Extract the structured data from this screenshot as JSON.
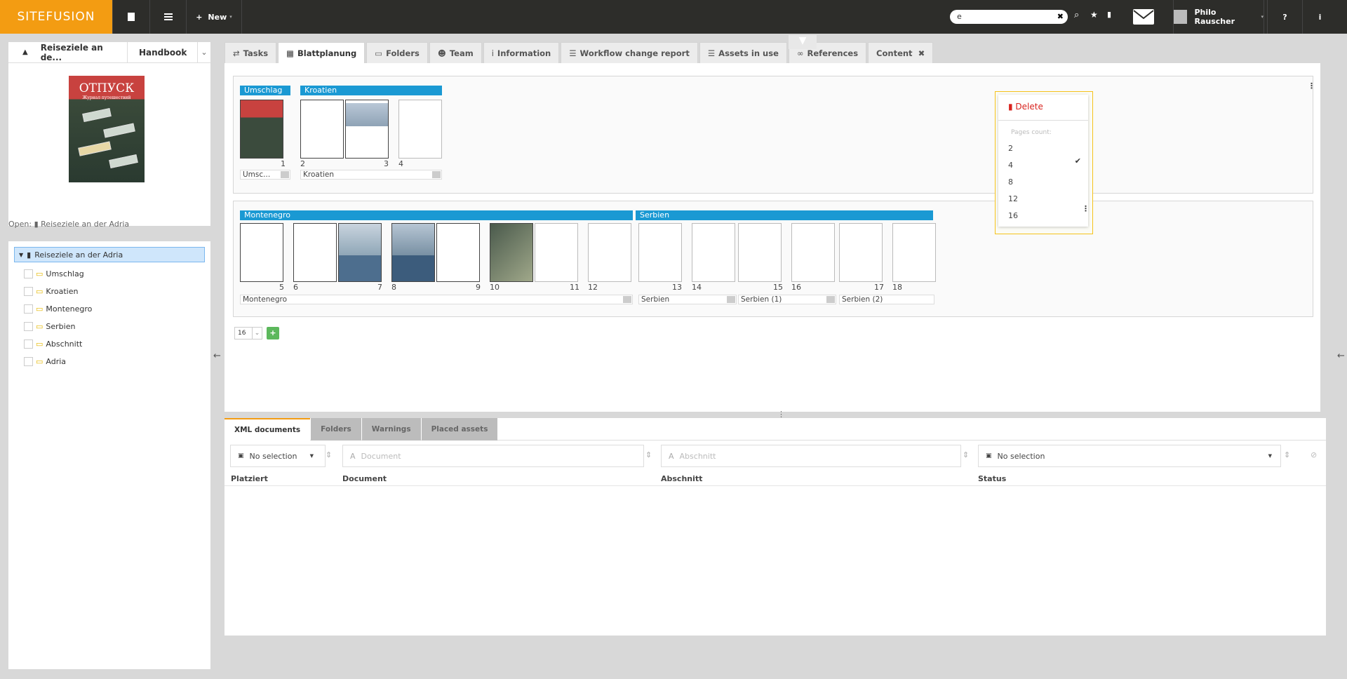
{
  "topbar": {
    "logo": "SITEFUSION",
    "new_label": "New",
    "search_value": "e",
    "user_name": "Philo Rauscher"
  },
  "left": {
    "doc_title": "Reiseziele an de...",
    "doc_type": "Handbook",
    "cover_title": "ОТПУСК",
    "cover_subtitle": "Журнал путешествий",
    "open_label": "Open:",
    "open_doc": "Reiseziele an der Adria",
    "tree_root": "Reiseziele an der Adria",
    "tree_items": [
      "Umschlag",
      "Kroatien",
      "Montenegro",
      "Serbien",
      "Abschnitt",
      "Adria"
    ]
  },
  "tabs": [
    "Tasks",
    "Blattplanung",
    "Folders",
    "Team",
    "Information",
    "Workflow change report",
    "Assets in use",
    "References",
    "Content"
  ],
  "planning": {
    "row1_chapters": [
      "Umschlag",
      "Kroatien"
    ],
    "row1_pages": [
      "1",
      "2",
      "3",
      "4"
    ],
    "row1_foot": [
      "Umsc...",
      "Kroatien"
    ],
    "row2_chapters": [
      "Montenegro",
      "Serbien"
    ],
    "row2_pages": [
      "5",
      "6",
      "7",
      "8",
      "9",
      "10",
      "11",
      "12",
      "13",
      "14",
      "15",
      "16",
      "17",
      "18"
    ],
    "row2_foot": [
      "Montenegro",
      "Serbien",
      "Serbien (1)",
      "Serbien (2)"
    ],
    "zoom": "16"
  },
  "dropdown": {
    "delete": "Delete",
    "caption": "Pages count:",
    "options": [
      "2",
      "4",
      "8",
      "12",
      "16"
    ],
    "selected": "4"
  },
  "lower": {
    "tabs": [
      "XML documents",
      "Folders",
      "Warnings",
      "Placed assets"
    ],
    "filter1": "No selection",
    "filter2_ph": "Document",
    "filter3_ph": "Abschnitt",
    "filter4": "No selection",
    "columns": [
      "Platziert",
      "Document",
      "Abschnitt",
      "Status"
    ]
  }
}
